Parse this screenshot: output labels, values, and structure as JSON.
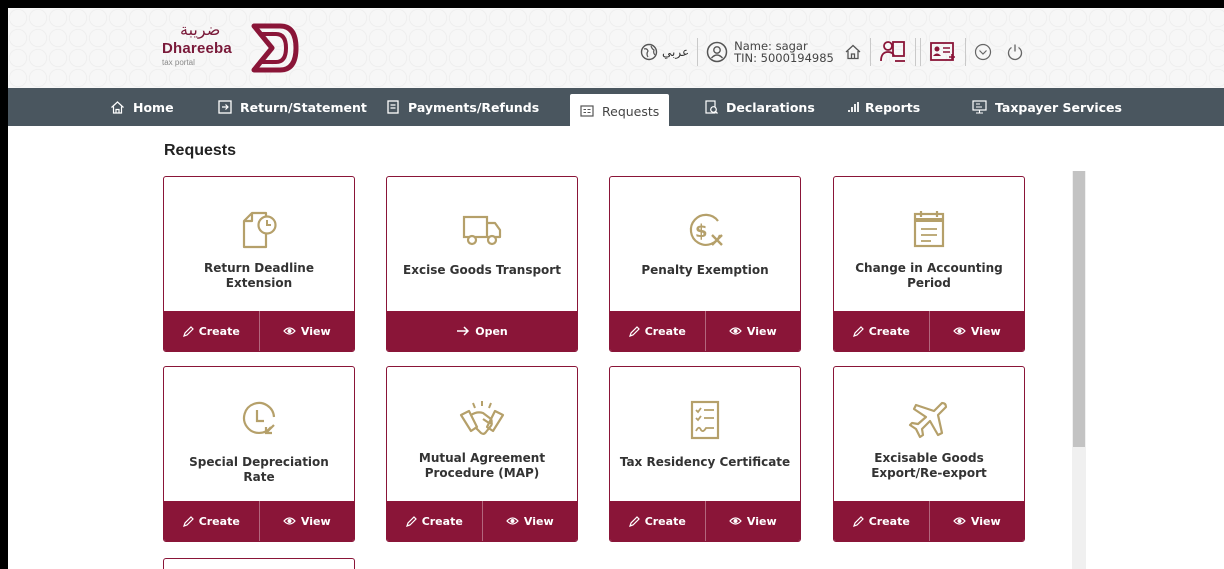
{
  "header": {
    "logo_ar": "ضريبة",
    "logo_en": "Dhareeba",
    "logo_sub": "tax portal",
    "language": "عربي",
    "user_name": "Name: sagar",
    "user_tin": "TIN: 5000194985"
  },
  "nav": [
    {
      "label": "Home",
      "icon": "home-icon"
    },
    {
      "label": "Return/Statement",
      "icon": "return-icon"
    },
    {
      "label": "Payments/Refunds",
      "icon": "payments-icon"
    },
    {
      "label": "Requests",
      "icon": "requests-icon",
      "active": true
    },
    {
      "label": "Declarations",
      "icon": "declarations-icon"
    },
    {
      "label": "Reports",
      "icon": "reports-icon"
    },
    {
      "label": "Taxpayer Services",
      "icon": "taxpayer-services-icon"
    }
  ],
  "page_title": "Requests",
  "cards": [
    {
      "title": "Return Deadline Extension",
      "icon": "document-clock-icon",
      "actions": [
        "Create",
        "View"
      ]
    },
    {
      "title": "Excise Goods Transport",
      "icon": "truck-icon",
      "actions": [
        "Open"
      ]
    },
    {
      "title": "Penalty Exemption",
      "icon": "dollar-x-icon",
      "actions": [
        "Create",
        "View"
      ]
    },
    {
      "title": "Change in Accounting Period",
      "icon": "calendar-icon",
      "actions": [
        "Create",
        "View"
      ]
    },
    {
      "title": "Special Depreciation Rate",
      "icon": "clock-arrow-icon",
      "actions": [
        "Create",
        "View"
      ]
    },
    {
      "title": "Mutual Agreement Procedure (MAP)",
      "icon": "handshake-icon",
      "actions": [
        "Create",
        "View"
      ]
    },
    {
      "title": "Tax Residency Certificate",
      "icon": "certificate-icon",
      "actions": [
        "Create",
        "View"
      ]
    },
    {
      "title": "Excisable Goods Export/Re-export",
      "icon": "airplane-icon",
      "actions": [
        "Create",
        "View"
      ]
    }
  ],
  "colors": {
    "accent": "#8a1538",
    "nav_bg": "#4a565f",
    "icon_gold": "#b5a06a"
  }
}
